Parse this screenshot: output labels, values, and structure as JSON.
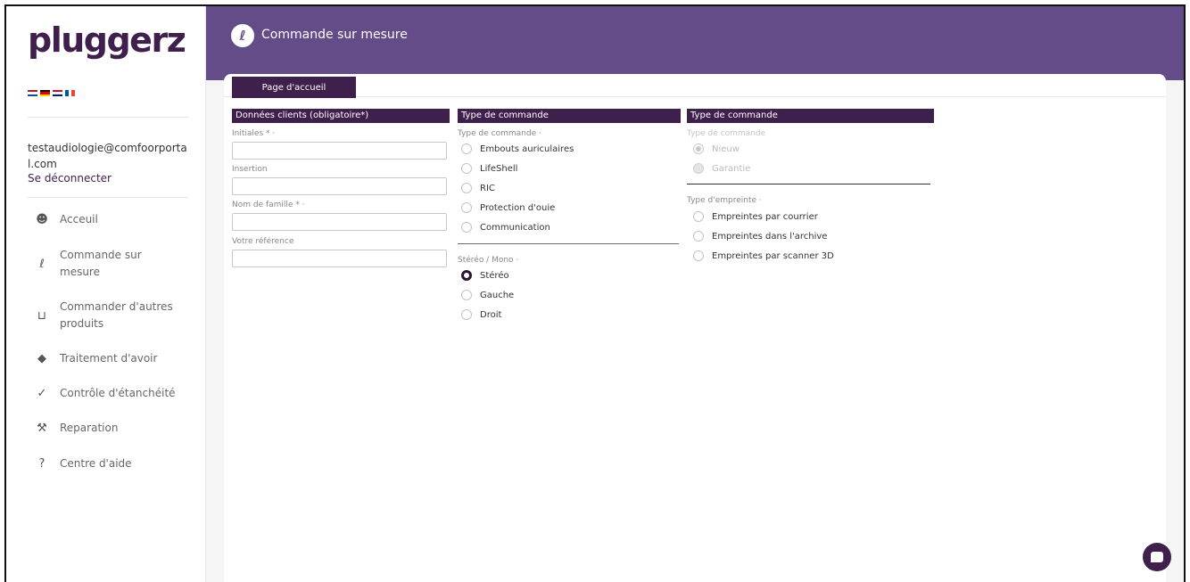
{
  "sidebar": {
    "logo": "pluggerz",
    "email": "testaudiologie@comfoorportal.com",
    "logout": "Se déconnecter",
    "nav": [
      {
        "label": "Acceuil",
        "icon": "user-icon"
      },
      {
        "label": "Commande sur mesure",
        "icon": "ear-icon"
      },
      {
        "label": "Commander d'autres produits",
        "icon": "cart-icon"
      },
      {
        "label": "Traitement d'avoir",
        "icon": "tag-icon"
      },
      {
        "label": "Contrôle d'étanchéité",
        "icon": "check-circle-icon"
      },
      {
        "label": "Reparation",
        "icon": "wrench-icon"
      },
      {
        "label": "Centre d'aide",
        "icon": "help-icon"
      }
    ]
  },
  "header": {
    "title": "Commande sur mesure"
  },
  "tabs": {
    "home": "Page d'accueil"
  },
  "clients": {
    "title": "Données clients (obligatoire*)",
    "fields": [
      {
        "label": "Initiales * ·",
        "value": ""
      },
      {
        "label": "Insertion",
        "value": ""
      },
      {
        "label": "Nom de famille * ·",
        "value": ""
      },
      {
        "label": "Votre référence",
        "value": ""
      }
    ]
  },
  "order_type": {
    "title": "Type de commande",
    "label": "Type de commande ·",
    "options": [
      "Embouts auriculaires",
      "LifeShell",
      "RIC",
      "Protection d'ouie",
      "Communication"
    ],
    "stereo_label": "Stéréo / Mono ·",
    "stereo_options": [
      "Stéréo",
      "Gauche",
      "Droit"
    ],
    "stereo_selected": "Stéréo"
  },
  "order_type2": {
    "title": "Type de commande",
    "label": "Type de commande",
    "options": [
      "Nieuw",
      "Garantie"
    ],
    "imprint_label": "Type d'empreinte ·",
    "imprint_options": [
      "Empreintes par courrier",
      "Empreintes dans l'archive",
      "Empreintes par scanner 3D"
    ]
  }
}
